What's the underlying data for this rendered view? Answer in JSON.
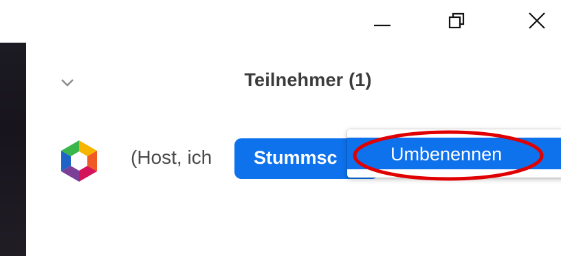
{
  "window_controls": {
    "minimize_icon": "minimize-icon",
    "restore_icon": "restore-icon",
    "close_icon": "close-icon"
  },
  "participants_panel": {
    "title": "Teilnehmer (1)",
    "collapse_icon": "chevron-down-icon"
  },
  "participant": {
    "avatar_icon": "zoom-hexagon-avatar",
    "name": "(Host, ich",
    "mute_button_label": "Stummsc"
  },
  "context_menu": {
    "items": [
      {
        "label": "Umbenennen"
      }
    ]
  },
  "colors": {
    "accent": "#0e72ed",
    "annotation": "#e00000",
    "title_text": "#3b3b3b"
  }
}
